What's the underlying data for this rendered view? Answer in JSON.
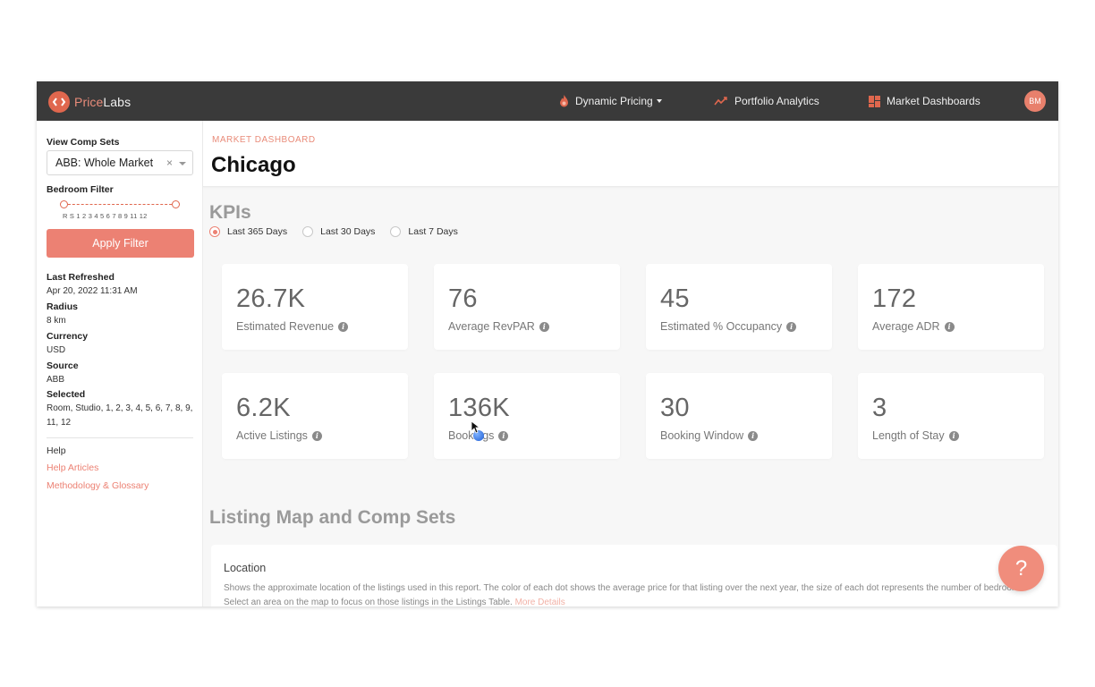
{
  "brand": {
    "name_part1": "Price",
    "name_part2": "Labs"
  },
  "nav": {
    "dynamic_pricing": "Dynamic Pricing",
    "portfolio_analytics": "Portfolio Analytics",
    "market_dashboards": "Market Dashboards",
    "avatar_initials": "BM"
  },
  "sidebar": {
    "view_comp_sets_label": "View Comp Sets",
    "comp_set_value": "ABB: Whole Market",
    "clear_icon": "×",
    "bedroom_filter_label": "Bedroom Filter",
    "bedroom_ticks": "R S 1 2 3 4 5 6 7 8 9 11 12",
    "apply_filter": "Apply Filter",
    "last_refreshed_label": "Last Refreshed",
    "last_refreshed_value": "Apr 20, 2022 11:31 AM",
    "radius_label": "Radius",
    "radius_value": "8 km",
    "currency_label": "Currency",
    "currency_value": "USD",
    "source_label": "Source",
    "source_value": "ABB",
    "selected_label": "Selected",
    "selected_value": "Room, Studio, 1, 2, 3, 4, 5, 6, 7, 8, 9, 11, 12",
    "help_label": "Help",
    "help_articles": "Help Articles",
    "methodology": "Methodology & Glossary"
  },
  "header": {
    "eyebrow": "MARKET DASHBOARD",
    "title": "Chicago"
  },
  "kpis": {
    "heading": "KPIs",
    "ranges": [
      "Last 365 Days",
      "Last 30 Days",
      "Last 7 Days"
    ],
    "selected_range": "Last 365 Days",
    "cards": [
      {
        "value": "26.7K",
        "label": "Estimated Revenue"
      },
      {
        "value": "76",
        "label": "Average RevPAR"
      },
      {
        "value": "45",
        "label": "Estimated % Occupancy"
      },
      {
        "value": "172",
        "label": "Average ADR"
      },
      {
        "value": "6.2K",
        "label": "Active Listings"
      },
      {
        "value": "136K",
        "label": "Bookings"
      },
      {
        "value": "30",
        "label": "Booking Window"
      },
      {
        "value": "3",
        "label": "Length of Stay"
      }
    ]
  },
  "listing_map": {
    "heading": "Listing Map and Comp Sets",
    "location_title": "Location",
    "location_desc": "Shows the approximate location of the listings used in this report. The color of each dot shows the average price for that listing over the next year, the size of each dot represents the number of bedrooms. Select an area on the map to focus on those listings in the Listings Table.",
    "more_details": "More Details"
  },
  "help_fab": "?",
  "colors": {
    "accent": "#ec8173",
    "nav_bg": "#3a3a3a"
  }
}
